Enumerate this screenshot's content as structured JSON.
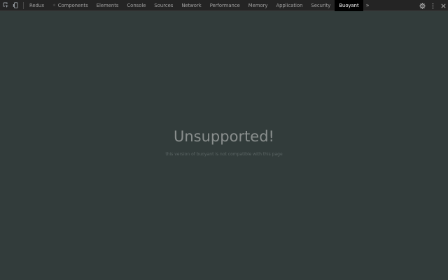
{
  "toolbar": {
    "tabs": [
      {
        "label": "Redux"
      },
      {
        "label": "Components",
        "icon": "react-icon"
      },
      {
        "label": "Elements"
      },
      {
        "label": "Console"
      },
      {
        "label": "Sources"
      },
      {
        "label": "Network"
      },
      {
        "label": "Performance"
      },
      {
        "label": "Memory"
      },
      {
        "label": "Application"
      },
      {
        "label": "Security"
      },
      {
        "label": "Buoyant",
        "active": true
      }
    ],
    "overflow_label": "»"
  },
  "panel": {
    "title": "Unsupported!",
    "subtitle": "this version of buoyant is not compatible with this page"
  },
  "colors": {
    "panel_background": "#323c3b",
    "toolbar_background": "#242424",
    "active_tab_background": "#000000"
  }
}
